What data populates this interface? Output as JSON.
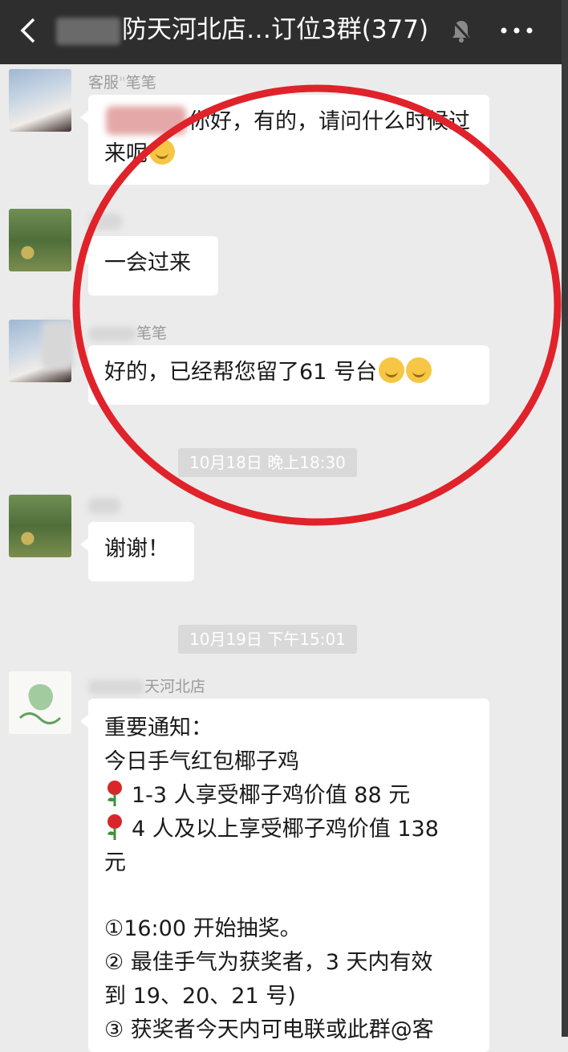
{
  "header": {
    "title": "防天河北店…订位3群(377)",
    "back_icon": "chevron-left-icon",
    "mute_icon": "bell-off-icon",
    "more_icon": "more-dots-icon"
  },
  "messages": [
    {
      "sender": "客服",
      "sender_suffix": "笔笔",
      "text": "你好，有的，请问什么时候过来呢"
    },
    {
      "sender": "",
      "text": "一会过来"
    },
    {
      "sender": "",
      "sender_suffix": "笔笔",
      "text": "好的，已经帮您留了61 号台"
    },
    {
      "sender": "",
      "text": "谢谢！"
    }
  ],
  "timestamps": [
    "10月18日 晚上18:30",
    "10月19日 下午15:01"
  ],
  "notice": {
    "sender": "天河北店",
    "lines": [
      "重要通知：",
      "今日手气红包椰子鸡",
      "1-3 人享受椰子鸡价值 88 元",
      "4 人及以上享受椰子鸡价值 138",
      "元",
      "",
      "①16:00 开始抽奖。",
      "② 最佳手气为获奖者，3 天内有效",
      "到 19、20、21 号)",
      "③ 获奖者今天内可电联或此群@客"
    ]
  },
  "colors": {
    "header_bg": "#2e2e2e",
    "chat_bg": "#ebebeb",
    "highlight": "#e0222a"
  }
}
